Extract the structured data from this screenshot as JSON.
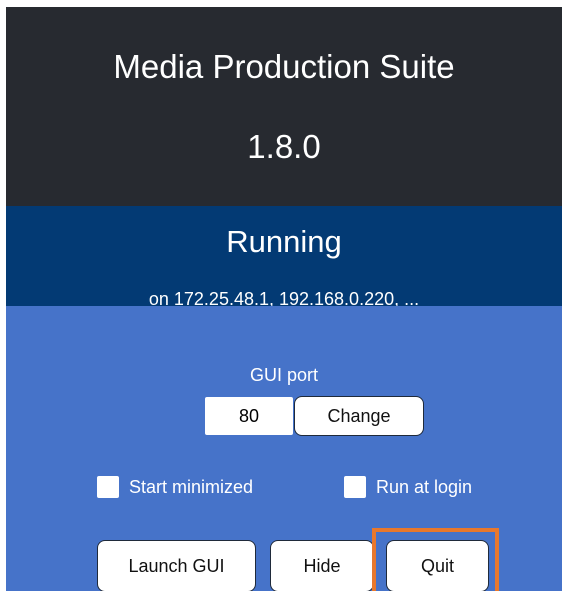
{
  "header": {
    "app_name": "Media Production Suite",
    "version": "1.8.0"
  },
  "status": {
    "state": "Running",
    "addresses": "on 172.25.48.1, 192.168.0.220, ..."
  },
  "gui_port": {
    "label": "GUI port",
    "value": "80",
    "change_label": "Change"
  },
  "options": {
    "start_minimized": {
      "label": "Start minimized",
      "checked": false
    },
    "run_at_login": {
      "label": "Run at login",
      "checked": false
    }
  },
  "actions": {
    "launch_label": "Launch GUI",
    "hide_label": "Hide",
    "quit_label": "Quit"
  },
  "colors": {
    "header_bg": "#272a30",
    "status_bg": "#033a74",
    "controls_bg": "#4673c9",
    "highlight": "#e8782d"
  }
}
